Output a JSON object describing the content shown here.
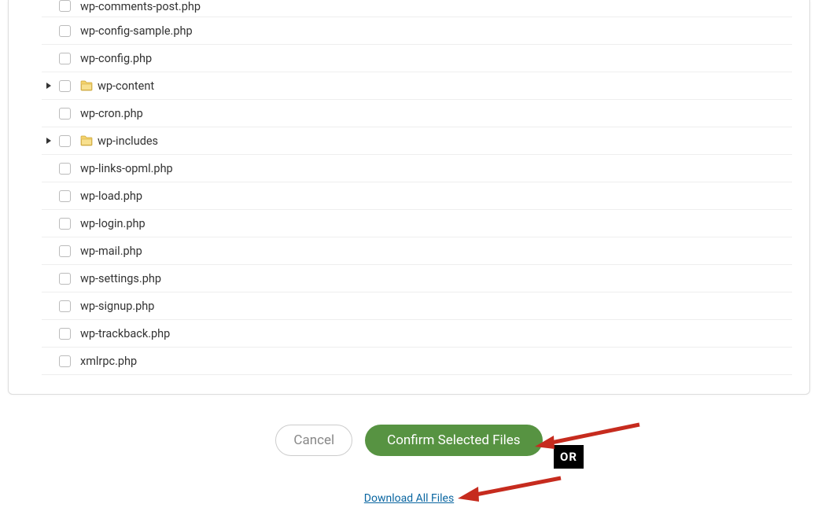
{
  "files": [
    {
      "name": "wp-comments-post.php",
      "type": "file"
    },
    {
      "name": "wp-config-sample.php",
      "type": "file"
    },
    {
      "name": "wp-config.php",
      "type": "file"
    },
    {
      "name": "wp-content",
      "type": "folder"
    },
    {
      "name": "wp-cron.php",
      "type": "file"
    },
    {
      "name": "wp-includes",
      "type": "folder"
    },
    {
      "name": "wp-links-opml.php",
      "type": "file"
    },
    {
      "name": "wp-load.php",
      "type": "file"
    },
    {
      "name": "wp-login.php",
      "type": "file"
    },
    {
      "name": "wp-mail.php",
      "type": "file"
    },
    {
      "name": "wp-settings.php",
      "type": "file"
    },
    {
      "name": "wp-signup.php",
      "type": "file"
    },
    {
      "name": "wp-trackback.php",
      "type": "file"
    },
    {
      "name": "xmlrpc.php",
      "type": "file"
    }
  ],
  "actions": {
    "cancel": "Cancel",
    "confirm": "Confirm Selected Files",
    "download_all": "Download All Files"
  },
  "annotation": {
    "or": "OR"
  }
}
